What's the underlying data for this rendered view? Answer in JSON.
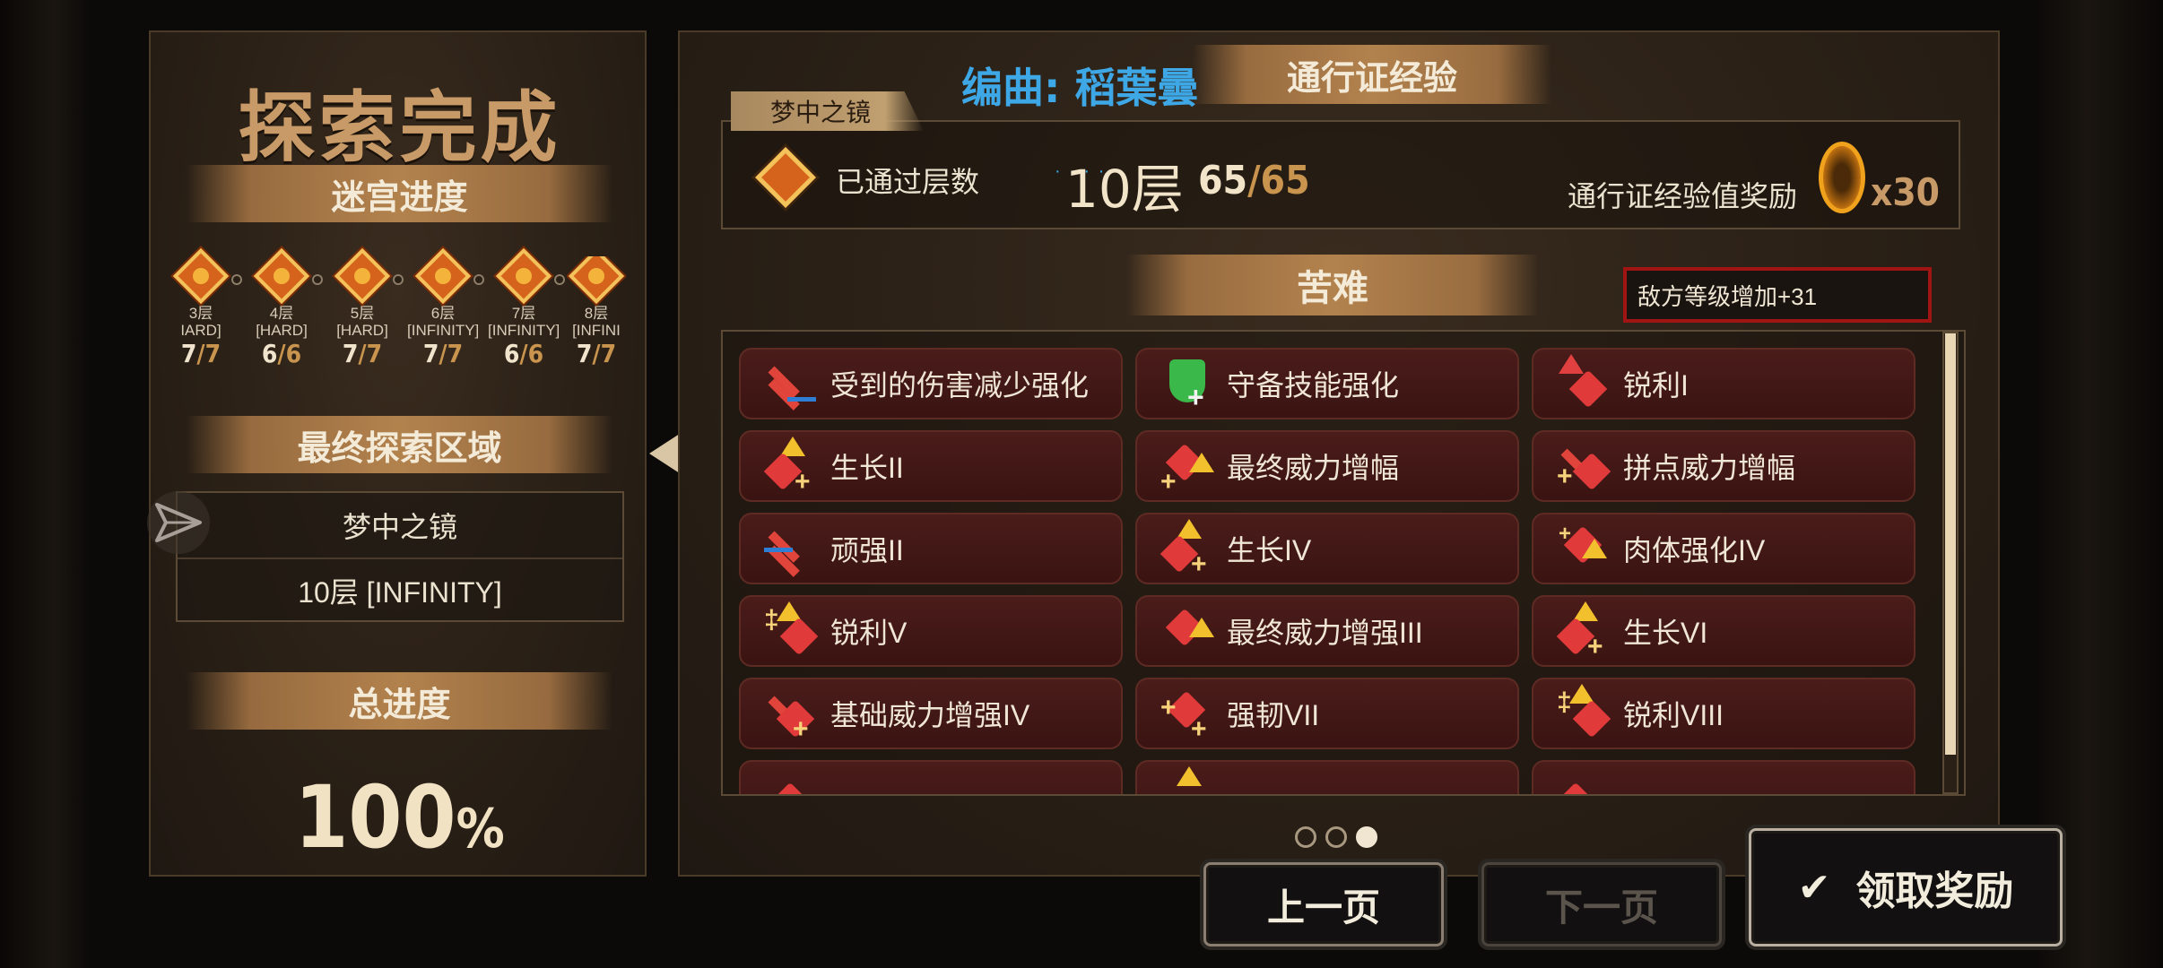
{
  "left": {
    "title": "探索完成",
    "maze_progress_label": "迷宫进度",
    "floors": [
      {
        "name_line1": "3层",
        "name_line2": "IARD]",
        "num": "7",
        "den": "/7"
      },
      {
        "name_line1": "4层",
        "name_line2": "[HARD]",
        "num": "6",
        "den": "/6"
      },
      {
        "name_line1": "5层",
        "name_line2": "[HARD]",
        "num": "7",
        "den": "/7"
      },
      {
        "name_line1": "6层",
        "name_line2": "[INFINITY]",
        "num": "7",
        "den": "/7"
      },
      {
        "name_line1": "7层",
        "name_line2": "[INFINITY]",
        "num": "6",
        "den": "/6"
      },
      {
        "name_line1": "8层",
        "name_line2": "[INFINI",
        "num": "7",
        "den": "/7"
      }
    ],
    "final_area_label": "最终探索区域",
    "final_area_name": "梦中之镜",
    "final_area_floor": "10层 [INFINITY]",
    "total_progress_label": "总进度",
    "total_progress_value": "100",
    "total_progress_sign": "%"
  },
  "right": {
    "credit": "编曲: 稻葉曇",
    "pass_exp_title": "通行证经验",
    "mirror_tab": "梦中之镜",
    "cleared_label": "已通过层数",
    "floor_value": "10层",
    "count_num": "65",
    "count_den": "/65",
    "reward_label": "通行证经验值奖励",
    "reward_count": "x30",
    "hardship_title": "苦难",
    "enemy_level": "敌方等级增加+31",
    "buffs": [
      {
        "label": "受到的伤害减少强化",
        "icon": "sword-down-icon"
      },
      {
        "label": "守备技能强化",
        "icon": "shield-plus-icon"
      },
      {
        "label": "锐利I",
        "icon": "sharp-heart-icon"
      },
      {
        "label": "生长II",
        "icon": "growth-heart-icon"
      },
      {
        "label": "最终威力增幅",
        "icon": "final-power-icon"
      },
      {
        "label": "拼点威力增幅",
        "icon": "clash-power-icon"
      },
      {
        "label": "顽强II",
        "icon": "tenacity-icon"
      },
      {
        "label": "生长IV",
        "icon": "growth-heart-icon"
      },
      {
        "label": "肉体强化IV",
        "icon": "body-boost-icon"
      },
      {
        "label": "锐利V",
        "icon": "sharp-heart-icon"
      },
      {
        "label": "最终威力增强III",
        "icon": "final-power-icon"
      },
      {
        "label": "生长VI",
        "icon": "growth-heart-icon"
      },
      {
        "label": "基础威力增强IV",
        "icon": "base-power-icon"
      },
      {
        "label": "强韧VII",
        "icon": "toughness-icon"
      },
      {
        "label": "锐利VIII",
        "icon": "sharp-heart-icon"
      },
      {
        "label": "",
        "icon": "partial-icon"
      },
      {
        "label": "",
        "icon": "partial-icon"
      },
      {
        "label": "",
        "icon": "partial-icon"
      }
    ],
    "page_indicator": {
      "total": 3,
      "current": 3
    }
  },
  "buttons": {
    "prev": "上一页",
    "next": "下一页",
    "claim": "领取奖励",
    "claim_check": "✔"
  },
  "colors": {
    "credit": "#3ea7e6",
    "enemy_border": "#a01414",
    "accent_gold": "#c89a68"
  }
}
